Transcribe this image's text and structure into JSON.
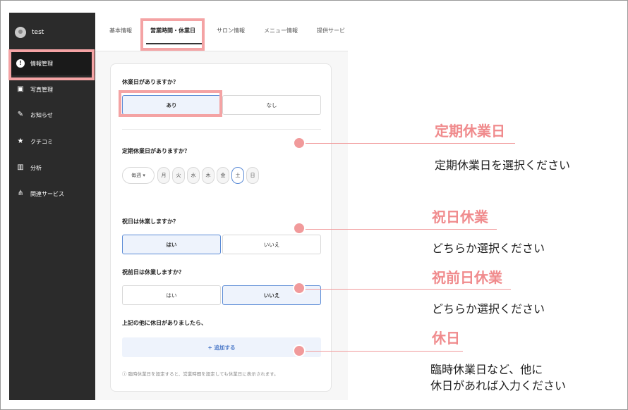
{
  "sidebar": {
    "user_name": "test",
    "items": [
      {
        "label": "情報管理",
        "icon": "info-icon"
      },
      {
        "label": "写真管理",
        "icon": "image-icon"
      },
      {
        "label": "お知らせ",
        "icon": "pencil-icon"
      },
      {
        "label": "クチコミ",
        "icon": "star-icon"
      },
      {
        "label": "分析",
        "icon": "chart-icon"
      },
      {
        "label": "関連サービス",
        "icon": "share-icon"
      }
    ]
  },
  "tabs": [
    "基本情報",
    "営業時間・休業日",
    "サロン情報",
    "メニュー情報",
    "提供サービ"
  ],
  "form": {
    "q1": "休業日がありますか？",
    "q1_yes": "あり",
    "q1_no": "なし",
    "q2": "定期休業日がありますか？",
    "frequency": "毎週 ▾",
    "days": [
      "月",
      "火",
      "水",
      "木",
      "金",
      "土",
      "日"
    ],
    "q3": "祝日は休業しますか？",
    "q3_yes": "はい",
    "q3_no": "いいえ",
    "q4": "祝前日は休業しますか？",
    "q4_yes": "はい",
    "q4_no": "いいえ",
    "q5": "上記の他に休日がありましたら、",
    "add_label": "+ 追加する",
    "note": "ⓘ 臨時休業日を設定すると、営業時間を設定しても休業日に表示されます。"
  },
  "annotations": [
    {
      "title": "定期休業日",
      "desc": "定期休業日を選択ください"
    },
    {
      "title": "祝日休業",
      "desc": "どちらか選択ください"
    },
    {
      "title": "祝前日休業",
      "desc": "どちらか選択ください"
    },
    {
      "title": "休日",
      "desc_line1": "臨時休業日など、他に",
      "desc_line2": "休日があれば入力ください"
    }
  ],
  "colors": {
    "accent": "#f08b8d",
    "highlight": "#f4a3a4",
    "selected_border": "#5b8bd6",
    "sidebar": "#2b2b2b"
  }
}
